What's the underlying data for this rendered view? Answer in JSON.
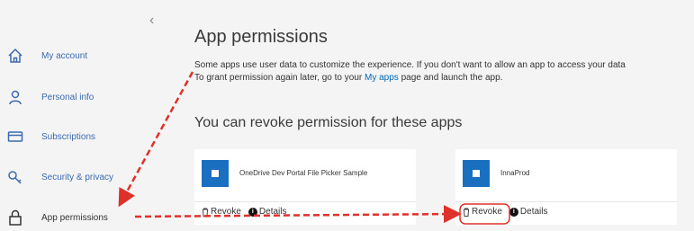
{
  "sidebar": {
    "items": [
      {
        "label": "My account",
        "icon": "home-icon"
      },
      {
        "label": "Personal info",
        "icon": "person-icon"
      },
      {
        "label": "Subscriptions",
        "icon": "card-icon"
      },
      {
        "label": "Security & privacy",
        "icon": "key-icon"
      },
      {
        "label": "App permissions",
        "icon": "lock-icon"
      }
    ]
  },
  "main": {
    "title": "App permissions",
    "description_line1": "Some apps use user data to customize the experience. If you don't want to allow an app to access your data",
    "description_line2_pre": "To grant permission again later, go to your ",
    "description_link": "My apps",
    "description_line2_post": " page and launch the app.",
    "subtitle": "You can revoke permission for these apps"
  },
  "apps": [
    {
      "name": "OneDrive Dev Portal File Picker Sample",
      "revoke_label": "Revoke",
      "details_label": "Details"
    },
    {
      "name": "InnaProd",
      "revoke_label": "Revoke",
      "details_label": "Details"
    }
  ],
  "colors": {
    "accent": "#1a6fc0",
    "link": "#0067b8",
    "annotation": "#e0302a"
  }
}
